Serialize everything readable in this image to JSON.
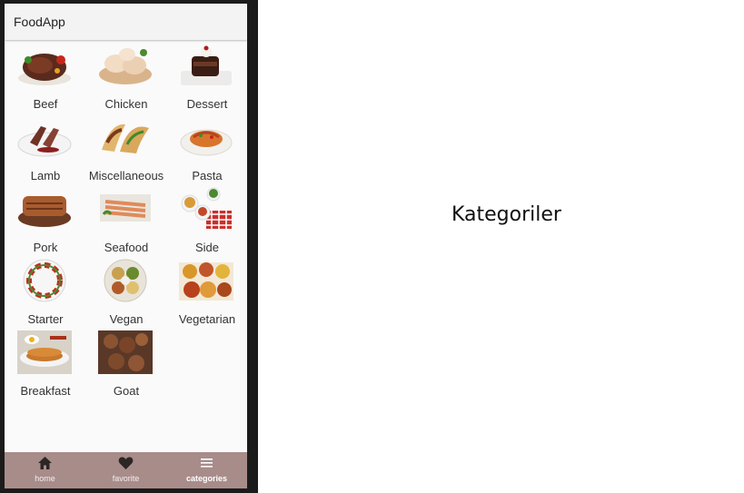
{
  "app": {
    "title": "FoodApp"
  },
  "categories": [
    {
      "label": "Beef",
      "icon": "beef-dish-image"
    },
    {
      "label": "Chicken",
      "icon": "chicken-dish-image"
    },
    {
      "label": "Dessert",
      "icon": "dessert-image"
    },
    {
      "label": "Lamb",
      "icon": "lamb-dish-image"
    },
    {
      "label": "Miscellaneous",
      "icon": "tacos-image"
    },
    {
      "label": "Pasta",
      "icon": "pasta-image"
    },
    {
      "label": "Pork",
      "icon": "pork-dish-image"
    },
    {
      "label": "Seafood",
      "icon": "seafood-image"
    },
    {
      "label": "Side",
      "icon": "side-dishes-image"
    },
    {
      "label": "Starter",
      "icon": "starter-plate-image"
    },
    {
      "label": "Vegan",
      "icon": "vegan-plate-image"
    },
    {
      "label": "Vegetarian",
      "icon": "vegetarian-spread-image"
    },
    {
      "label": "Breakfast",
      "icon": "breakfast-image"
    },
    {
      "label": "Goat",
      "icon": "goat-dish-image"
    }
  ],
  "bottom_nav": {
    "items": [
      {
        "label": "home",
        "icon": "home-icon",
        "active": false
      },
      {
        "label": "favorite",
        "icon": "heart-icon",
        "active": false
      },
      {
        "label": "categories",
        "icon": "menu-icon",
        "active": true
      }
    ],
    "background": "#a88c8a"
  },
  "side_caption": "Kategoriler"
}
